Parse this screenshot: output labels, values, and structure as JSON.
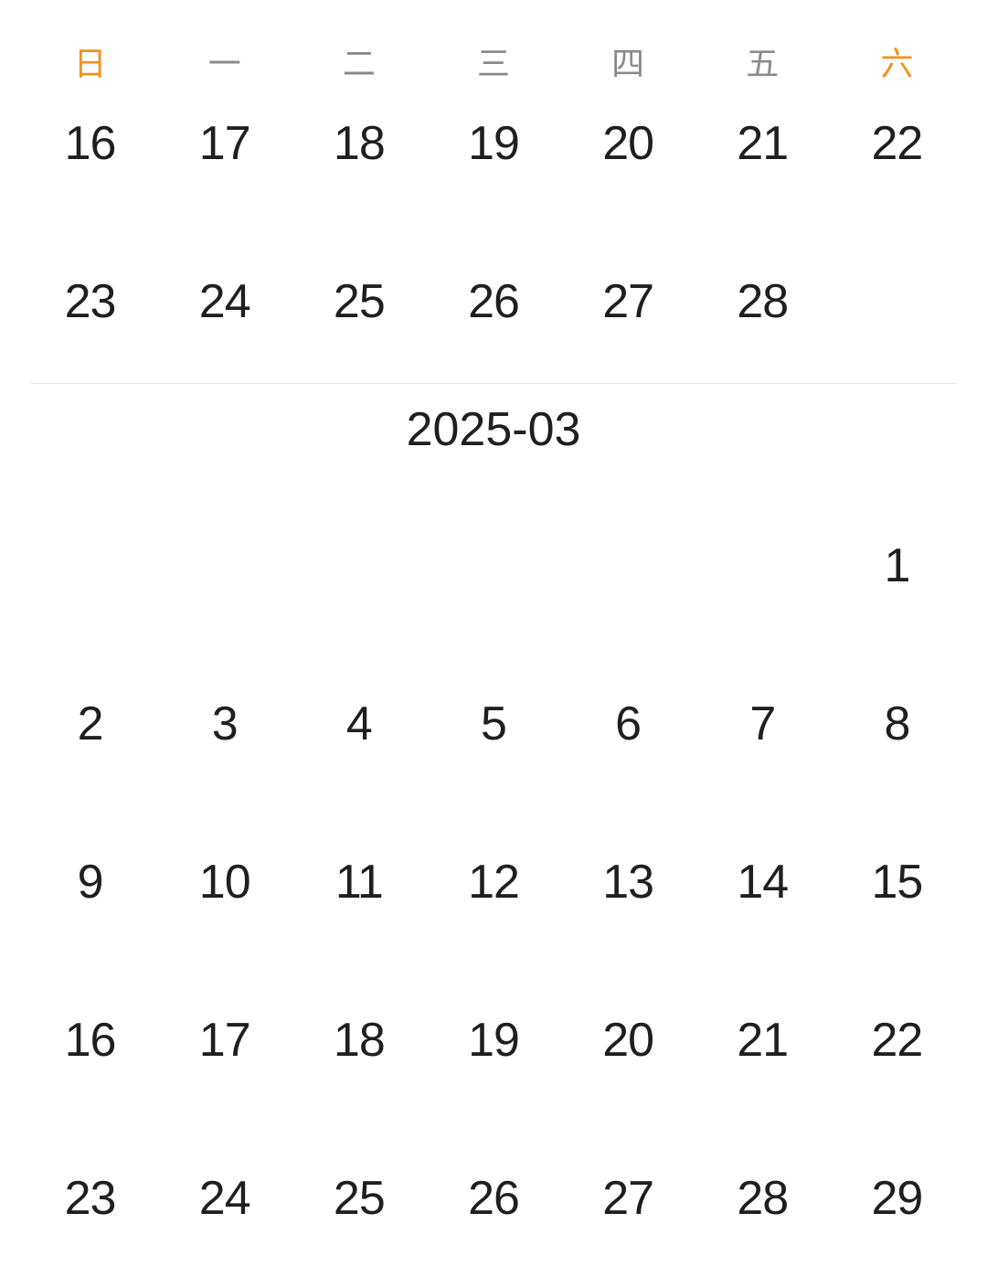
{
  "weekdays": [
    {
      "label": "日",
      "weekend": true
    },
    {
      "label": "一",
      "weekend": false
    },
    {
      "label": "二",
      "weekend": false
    },
    {
      "label": "三",
      "weekend": false
    },
    {
      "label": "四",
      "weekend": false
    },
    {
      "label": "五",
      "weekend": false
    },
    {
      "label": "六",
      "weekend": true
    }
  ],
  "colors": {
    "weekend": "#f0921e",
    "weekday": "#8a8a8a",
    "day_text": "#1f1f1f",
    "divider": "#e8e8e8"
  },
  "february": {
    "rows": [
      [
        "16",
        "17",
        "18",
        "19",
        "20",
        "21",
        "22"
      ],
      [
        "23",
        "24",
        "25",
        "26",
        "27",
        "28",
        ""
      ]
    ]
  },
  "march": {
    "title": "2025-03",
    "rows": [
      [
        "",
        "",
        "",
        "",
        "",
        "",
        "1"
      ],
      [
        "2",
        "3",
        "4",
        "5",
        "6",
        "7",
        "8"
      ],
      [
        "9",
        "10",
        "11",
        "12",
        "13",
        "14",
        "15"
      ],
      [
        "16",
        "17",
        "18",
        "19",
        "20",
        "21",
        "22"
      ],
      [
        "23",
        "24",
        "25",
        "26",
        "27",
        "28",
        "29"
      ]
    ]
  }
}
